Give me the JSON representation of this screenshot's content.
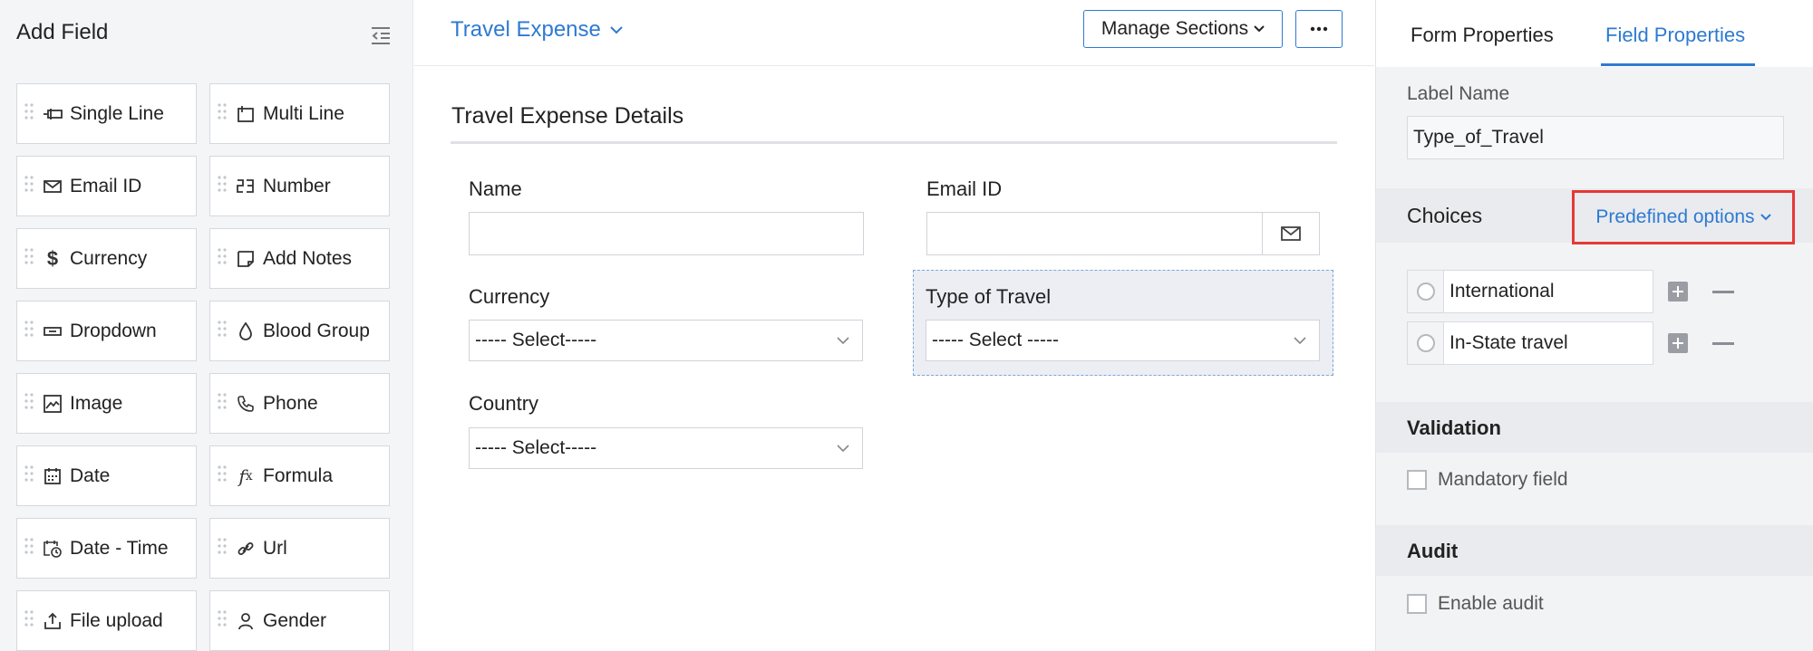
{
  "left_panel": {
    "title": "Add Field",
    "fields": [
      {
        "label": "Single Line",
        "icon": "single-line-icon"
      },
      {
        "label": "Multi Line",
        "icon": "multi-line-icon"
      },
      {
        "label": "Email ID",
        "icon": "email-icon"
      },
      {
        "label": "Number",
        "icon": "number-icon"
      },
      {
        "label": "Currency",
        "icon": "currency-icon"
      },
      {
        "label": "Add Notes",
        "icon": "notes-icon"
      },
      {
        "label": "Dropdown",
        "icon": "dropdown-icon"
      },
      {
        "label": "Blood Group",
        "icon": "blood-drop-icon"
      },
      {
        "label": "Image",
        "icon": "image-icon"
      },
      {
        "label": "Phone",
        "icon": "phone-icon"
      },
      {
        "label": "Date",
        "icon": "calendar-icon"
      },
      {
        "label": "Formula",
        "icon": "formula-icon"
      },
      {
        "label": "Date - Time",
        "icon": "date-time-icon"
      },
      {
        "label": "Url",
        "icon": "link-icon"
      },
      {
        "label": "File upload",
        "icon": "upload-icon"
      },
      {
        "label": "Gender",
        "icon": "person-icon"
      }
    ]
  },
  "form": {
    "title": "Travel Expense",
    "manage_sections": "Manage Sections",
    "section_title": "Travel Expense Details",
    "fields": {
      "name_label": "Name",
      "email_label": "Email ID",
      "currency_label": "Currency",
      "currency_value": "----- Select-----",
      "type_label": "Type of Travel",
      "type_value": "----- Select -----",
      "country_label": "Country",
      "country_value": "----- Select-----"
    }
  },
  "properties": {
    "tabs": {
      "form": "Form Properties",
      "field": "Field Properties",
      "active": "field"
    },
    "label_name_caption": "Label Name",
    "label_name_value": "Type_of_Travel",
    "choices_title": "Choices",
    "predefined_options": "Predefined options",
    "choices": [
      "International",
      "In-State travel"
    ],
    "validation_title": "Validation",
    "mandatory_label": "Mandatory field",
    "mandatory_checked": false,
    "audit_title": "Audit",
    "audit_label": "Enable audit",
    "audit_checked": false
  },
  "colors": {
    "accent": "#2e7ad1",
    "highlight_border": "#e53935"
  }
}
